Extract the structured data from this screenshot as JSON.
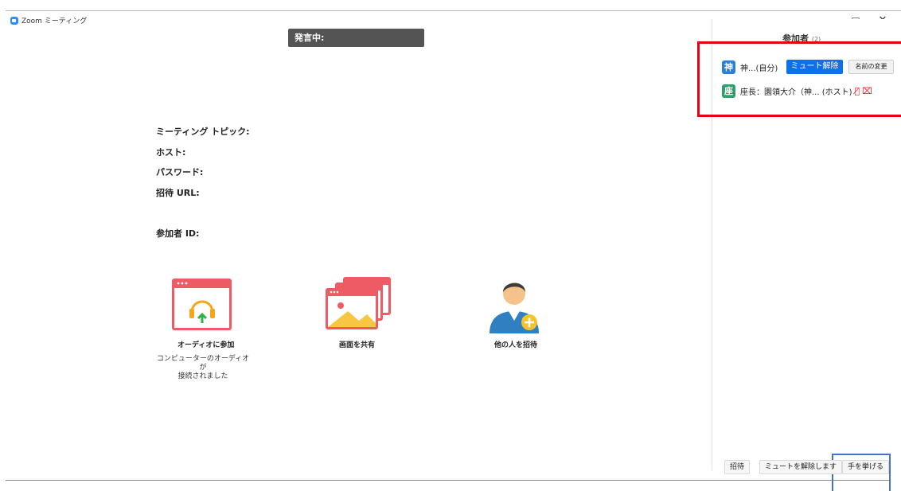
{
  "window": {
    "title": "Zoom ミーティング"
  },
  "speaking": "発言中:",
  "meeting_info": {
    "topic": "ミーティング トピック:",
    "host": "ホスト:",
    "password": "パスワード:",
    "invite_url": "招待 URL:",
    "participant_id": "参加者 ID:"
  },
  "actions": {
    "audio": {
      "label": "オーディオに参加",
      "sub1": "コンピューターのオーディオが",
      "sub2": "接続されました"
    },
    "share": {
      "label": "画面を共有"
    },
    "invite": {
      "label": "他の人を招待"
    }
  },
  "panel": {
    "title": "参加者",
    "count": "(2)",
    "participants": [
      {
        "avatar": "神",
        "name": "神...(自分)",
        "color": "#2d7fd3"
      },
      {
        "avatar": "座",
        "name": "座長：園領大介（神... (ホスト)",
        "color": "#2aa06a"
      }
    ],
    "unmute_label": "ミュート解除",
    "rename_label": "名前の変更",
    "footer": {
      "invite": "招待",
      "unmute_all": "ミュートを解除します",
      "raise_hand": "手を挙げる"
    }
  },
  "colors": {
    "accent": "#0e71eb",
    "annotation_red": "#e60012",
    "annotation_blue": "#4472c4"
  }
}
